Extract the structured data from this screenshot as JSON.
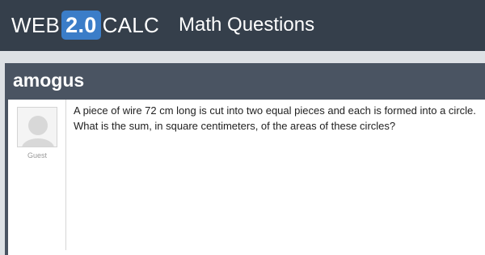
{
  "header": {
    "logo_prefix": "WEB",
    "logo_badge": "2.0",
    "logo_suffix": "CALC",
    "section": "Math Questions"
  },
  "question": {
    "title": "amogus",
    "author": "Guest",
    "text": "A piece of wire 72 cm long is cut into two equal pieces and each is formed into a circle. What is the sum, in square centimeters, of the areas of these circles?"
  },
  "colors": {
    "header_bg": "#353f4b",
    "badge": "#3b7dc8",
    "panel_bg": "#4a5462",
    "page_bg": "#dde1e5"
  }
}
